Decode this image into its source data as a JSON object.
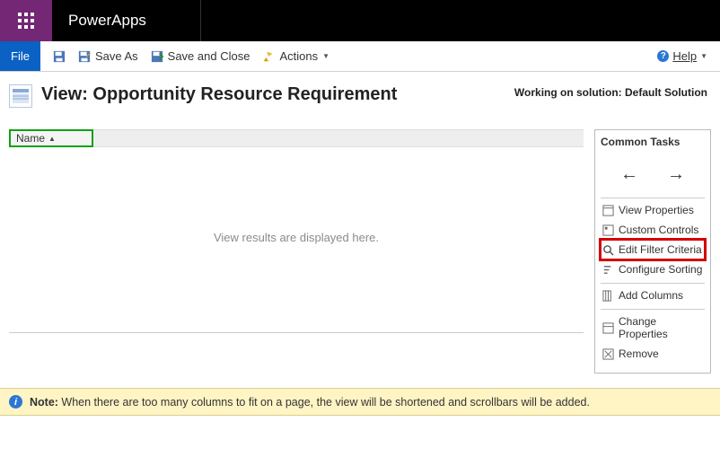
{
  "appTitle": "PowerApps",
  "cmdbar": {
    "file": "File",
    "saveAs": "Save As",
    "saveAndClose": "Save and Close",
    "actions": "Actions",
    "help": "Help"
  },
  "header": {
    "viewLabel": "View: Opportunity Resource Requirement",
    "solutionLabel": "Working on solution: Default Solution"
  },
  "grid": {
    "column1": "Name",
    "placeholder": "View results are displayed here."
  },
  "tasks": {
    "title": "Common Tasks",
    "viewProperties": "View Properties",
    "customControls": "Custom Controls",
    "editFilterCriteria": "Edit Filter Criteria",
    "configureSorting": "Configure Sorting",
    "addColumns": "Add Columns",
    "changeProperties": "Change Properties",
    "remove": "Remove"
  },
  "note": {
    "label": "Note:",
    "text": " When there are too many columns to fit on a page, the view will be shortened and scrollbars will be added."
  }
}
